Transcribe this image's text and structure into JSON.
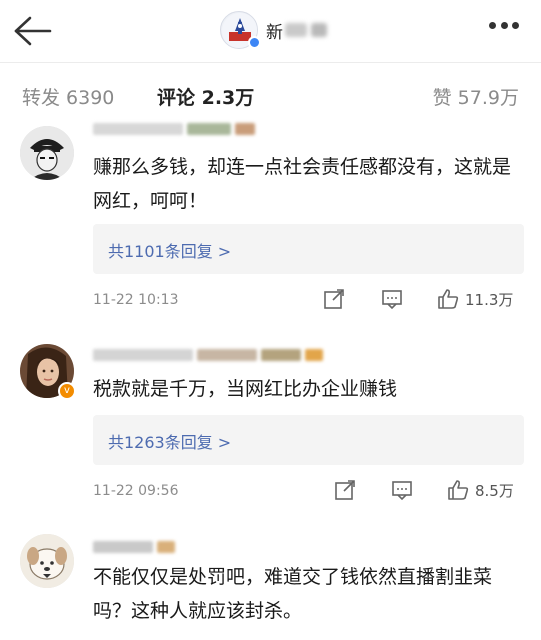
{
  "header": {
    "back_icon": "arrow-left-icon",
    "account_name": "新",
    "more_icon": "more-dots-icon"
  },
  "tabs": {
    "repost": "转发 6390",
    "comment": "评论 2.3万",
    "like": "赞 57.9万"
  },
  "comments": [
    {
      "text": "赚那么多钱，却连一点社会责任感都没有，这就是网红，呵呵！",
      "replies": "共1101条回复 >",
      "time": "11-22 10:13",
      "likes": "11.3万"
    },
    {
      "text": "税款就是千万，当网红比办企业赚钱",
      "replies": "共1263条回复 >",
      "time": "11-22 09:56",
      "likes": "8.5万"
    },
    {
      "text": "不能仅仅是处罚吧，难道交了钱依然直播割韭菜吗？这种人就应该封杀。"
    }
  ],
  "colors": {
    "accent": "#ff8200",
    "link": "#4d6bb0",
    "verify_orange": "#f38c00",
    "verify_blue": "#3d86f5"
  }
}
